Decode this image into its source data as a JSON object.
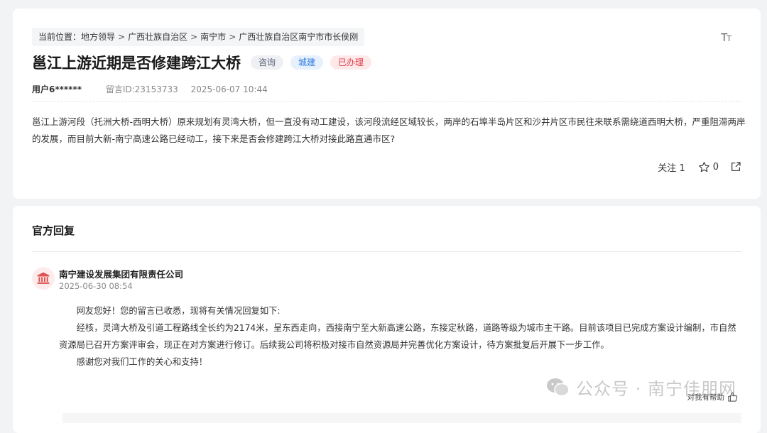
{
  "breadcrumb": {
    "prefix": "当前位置：",
    "items": [
      "地方领导",
      "广西壮族自治区",
      "南宁市",
      "广西壮族自治区南宁市市长侯刚"
    ],
    "separator": ">"
  },
  "font_toggle_label": "Tт",
  "question": {
    "title": "邕江上游近期是否修建跨江大桥",
    "tags": [
      {
        "label": "咨询",
        "color": "#5b6478"
      },
      {
        "label": "城建",
        "color": "#2f7be0"
      },
      {
        "label": "已办理",
        "color": "#e23a46"
      }
    ],
    "user": "用户6******",
    "message_id": "留言ID:23153733",
    "datetime": "2025-06-07 10:44",
    "body": "邕江上游河段（托洲大桥-西明大桥）原来规划有灵湾大桥，但一直没有动工建设，该河段流经区域较长，两岸的石埠半岛片区和沙井片区市民往来联系需绕道西明大桥，严重阻滞两岸的发展，而目前大新-南宁高速公路已经动工，接下来是否会修建跨江大桥对接此路直通市区?",
    "actions": {
      "follow_label": "关注",
      "follow_count": "1",
      "star_count": "0"
    }
  },
  "reply": {
    "section_title": "官方回复",
    "org_name": "南宁建设发展集团有限责任公司",
    "datetime": "2025-06-30 08:54",
    "paragraphs": [
      "网友您好！您的留言已收悉，现将有关情况回复如下:",
      "经核，灵湾大桥及引道工程路线全长约为2174米，呈东西走向，西接南宁至大新高速公路，东接定秋路，道路等级为城市主干路。目前该项目已完成方案设计编制，市自然资源局已召开方案评审会，现正在对方案进行修订。后续我公司将积极对接市自然资源局并完善优化方案设计，待方案批复后开展下一步工作。",
      "感谢您对我们工作的关心和支持！"
    ],
    "helpful_label": "对我有帮助"
  },
  "watermark": "公众号 · 南宁佳朋网",
  "colors": {
    "background": "#f2f3f5",
    "accent_red": "#e23a46",
    "accent_blue": "#2f7be0"
  }
}
